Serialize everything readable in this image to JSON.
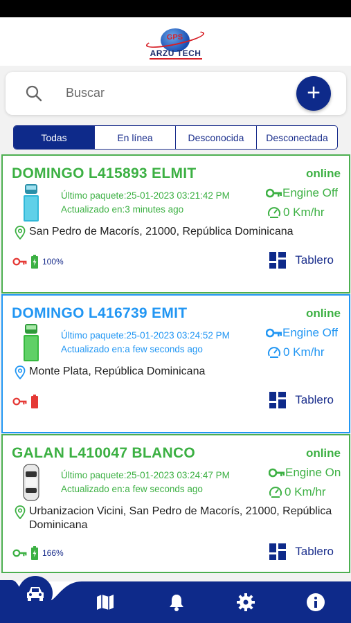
{
  "app": {
    "logo_badge": "GPS",
    "logo_name": "ARZU TECH"
  },
  "search": {
    "placeholder": "Buscar",
    "add_label": "+"
  },
  "tabs": [
    {
      "label": "Todas",
      "active": true
    },
    {
      "label": "En línea",
      "active": false
    },
    {
      "label": "Desconocida",
      "active": false
    },
    {
      "label": "Desconectada",
      "active": false
    }
  ],
  "colors": {
    "primary": "#0e2a8a",
    "online_green": "#3cb043",
    "name_blue": "#2196f3",
    "key_red": "#e53935"
  },
  "vehicles": [
    {
      "name": "DOMINGO L415893 ELMIT",
      "status": "online",
      "last_packet": "Último paquete:25-01-2023 03:21:42 PM",
      "updated": "Actualizado en:3 minutes ago",
      "engine": "Engine Off",
      "speed": "0 Km/hr",
      "address": "San Pedro de Macorís, 21000, República Dominicana",
      "battery_pct": "100%",
      "dashboard": "Tablero",
      "icon": "truck-icon",
      "key_state": "off"
    },
    {
      "name": "DOMINGO L416739 EMIT",
      "status": "online",
      "last_packet": "Último paquete:25-01-2023 03:24:52 PM",
      "updated": "Actualizado en:a few seconds ago",
      "engine": "Engine Off",
      "speed": "0 Km/hr",
      "address": "Monte Plata, República Dominicana",
      "battery_pct": "",
      "dashboard": "Tablero",
      "icon": "truck-icon",
      "key_state": "off"
    },
    {
      "name": "GALAN L410047 BLANCO",
      "status": "online",
      "last_packet": "Último paquete:25-01-2023 03:24:47 PM",
      "updated": "Actualizado en:a few seconds ago",
      "engine": "Engine On",
      "speed": "0 Km/hr",
      "address": "Urbanizacion Vicini, San Pedro de Macorís, 21000, República Dominicana",
      "battery_pct": "166%",
      "dashboard": "Tablero",
      "icon": "car-icon",
      "key_state": "on"
    }
  ],
  "nav": [
    "car-icon",
    "map-icon",
    "bell-icon",
    "gear-icon",
    "info-icon"
  ]
}
